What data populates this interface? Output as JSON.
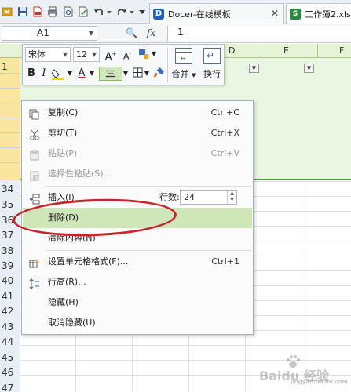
{
  "tabs": [
    {
      "label": "Docer-在线模板",
      "logo": "D"
    },
    {
      "label": "工作簿2.xls",
      "logo": "S"
    }
  ],
  "formula_bar": {
    "cell_ref": "A1",
    "value": "1",
    "fx": "fx"
  },
  "columns": [
    "D",
    "E",
    "F"
  ],
  "rows_visible": [
    "1",
    "34",
    "35",
    "36",
    "37",
    "38",
    "39",
    "40",
    "41",
    "42",
    "43",
    "44",
    "45",
    "46",
    "47"
  ],
  "mini_toolbar": {
    "font_name": "宋体",
    "font_size": "12",
    "merge_label": "合并",
    "wrap_label": "换行"
  },
  "context_menu": {
    "items": [
      {
        "label": "复制(C)",
        "shortcut": "Ctrl+C",
        "icon": "copy-icon",
        "disabled": false
      },
      {
        "label": "剪切(T)",
        "shortcut": "Ctrl+X",
        "icon": "scissors-icon",
        "disabled": false
      },
      {
        "label": "粘贴(P)",
        "shortcut": "Ctrl+V",
        "icon": "paste-icon",
        "disabled": true
      },
      {
        "label": "选择性粘贴(S)...",
        "shortcut": "",
        "icon": "paste-special-icon",
        "disabled": true
      },
      {
        "label": "插入(I)",
        "shortcut": "",
        "icon": "insert-rows-icon",
        "disabled": false
      },
      {
        "label": "删除(D)",
        "shortcut": "",
        "icon": "",
        "disabled": false
      },
      {
        "label": "清除内容(N)",
        "shortcut": "",
        "icon": "",
        "disabled": false
      },
      {
        "label": "设置单元格格式(F)...",
        "shortcut": "Ctrl+1",
        "icon": "format-cells-icon",
        "disabled": false
      },
      {
        "label": "行高(R)...",
        "shortcut": "",
        "icon": "row-height-icon",
        "disabled": false
      },
      {
        "label": "隐藏(H)",
        "shortcut": "",
        "icon": "",
        "disabled": false
      },
      {
        "label": "取消隐藏(U)",
        "shortcut": "",
        "icon": "",
        "disabled": false
      }
    ],
    "rows_label": "行数:",
    "rows_value": "24",
    "highlighted": "删除(D)"
  },
  "colors": {
    "accent_green": "#cfe6b9",
    "ring_red": "#c4262b",
    "header_green": "#e7f3d7"
  },
  "watermark": {
    "text": "Baidu 经验",
    "sub": "jingyan.baidu.com"
  }
}
